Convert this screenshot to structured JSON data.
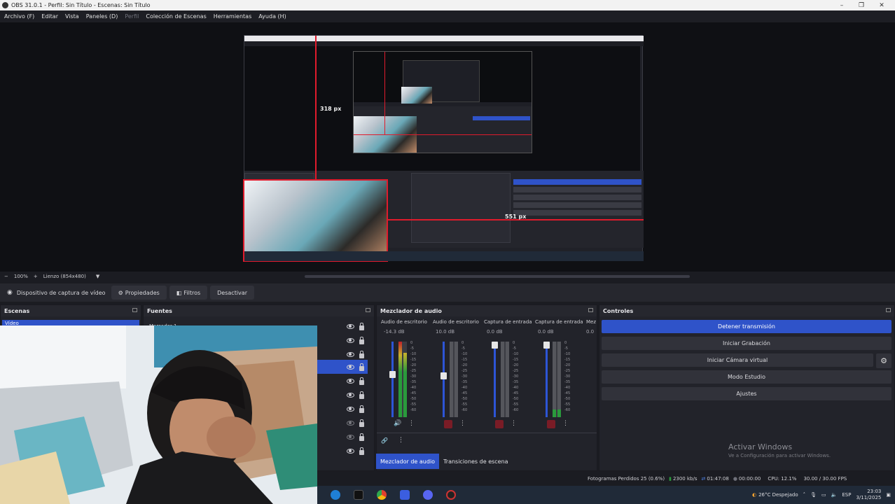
{
  "window": {
    "title": "OBS 31.0.1 - Perfil: Sin Título - Escenas: Sin Título",
    "minimize": "–",
    "maximize": "❐",
    "close": "✕"
  },
  "menu": [
    "Archivo (F)",
    "Editar",
    "Vista",
    "Paneles (D)",
    "Perfil",
    "Colección de Escenas",
    "Herramientas",
    "Ayuda (H)"
  ],
  "preview": {
    "measure_top": "318 px",
    "measure_right": "551 px"
  },
  "zoom": {
    "minus": "−",
    "value": "100%",
    "plus": "+",
    "canvas": "Lienzo (854x480)"
  },
  "source_toolbar": {
    "source_name": "Dispositivo de captura de vídeo",
    "properties": "Propiedades",
    "filters": "Filtros",
    "deactivate": "Desactivar"
  },
  "scenes": {
    "title": "Escenas",
    "items": [
      "Vídeo"
    ]
  },
  "sources": {
    "title": "Fuentes",
    "items": [
      {
        "name": "Marcador 1",
        "visible": true,
        "locked": false
      },
      {
        "name": "",
        "visible": true,
        "locked": false
      },
      {
        "name": "",
        "visible": true,
        "locked": false
      },
      {
        "name": "",
        "visible": true,
        "locked": false,
        "selected": true
      },
      {
        "name": "",
        "visible": true,
        "locked": false
      },
      {
        "name": "",
        "visible": true,
        "locked": false
      },
      {
        "name": "",
        "visible": true,
        "locked": false
      },
      {
        "name": "",
        "visible": false,
        "locked": true
      },
      {
        "name": "",
        "visible": false,
        "locked": true
      },
      {
        "name": "",
        "visible": true,
        "locked": true
      }
    ]
  },
  "mixer": {
    "title": "Mezclador de audio",
    "channels": [
      {
        "name": "Audio de escritorio",
        "db": "-14.3 dB"
      },
      {
        "name": "Audio de escritorio",
        "db": "10.0 dB"
      },
      {
        "name": "Captura de entrada",
        "db": "0.0 dB"
      },
      {
        "name": "Captura de entrada",
        "db": "0.0 dB"
      }
    ],
    "extra_name": "Mez",
    "extra_db": "0.0",
    "ticks": [
      "0",
      "-5",
      "-10",
      "-15",
      "-20",
      "-25",
      "-30",
      "-35",
      "-40",
      "-45",
      "-50",
      "-55",
      "-60"
    ],
    "tabs": [
      "Mezclador de audio",
      "Transiciones de escena"
    ]
  },
  "controls": {
    "title": "Controles",
    "buttons": [
      "Detener transmisión",
      "Iniciar Grabación",
      "Iniciar Cámara virtual",
      "Modo Estudio",
      "Ajustes"
    ]
  },
  "watermark": {
    "line1": "Activar Windows",
    "line2": "Ve a Configuración para activar Windows."
  },
  "status": {
    "dropped": "Fotogramas Perdidos 25 (0.6%)",
    "bitrate": "2300 kb/s",
    "live": "01:47:08",
    "rec": "00:00:00",
    "cpu": "CPU: 12.1%",
    "fps": "30.00 / 30.00 FPS"
  },
  "taskbar": {
    "weather": "26°C  Despejado",
    "lang": "ESP",
    "time": "23:03",
    "date": "3/11/2025"
  },
  "colors": {
    "accent": "#2f53c9",
    "selection_red": "#e01b2c"
  }
}
